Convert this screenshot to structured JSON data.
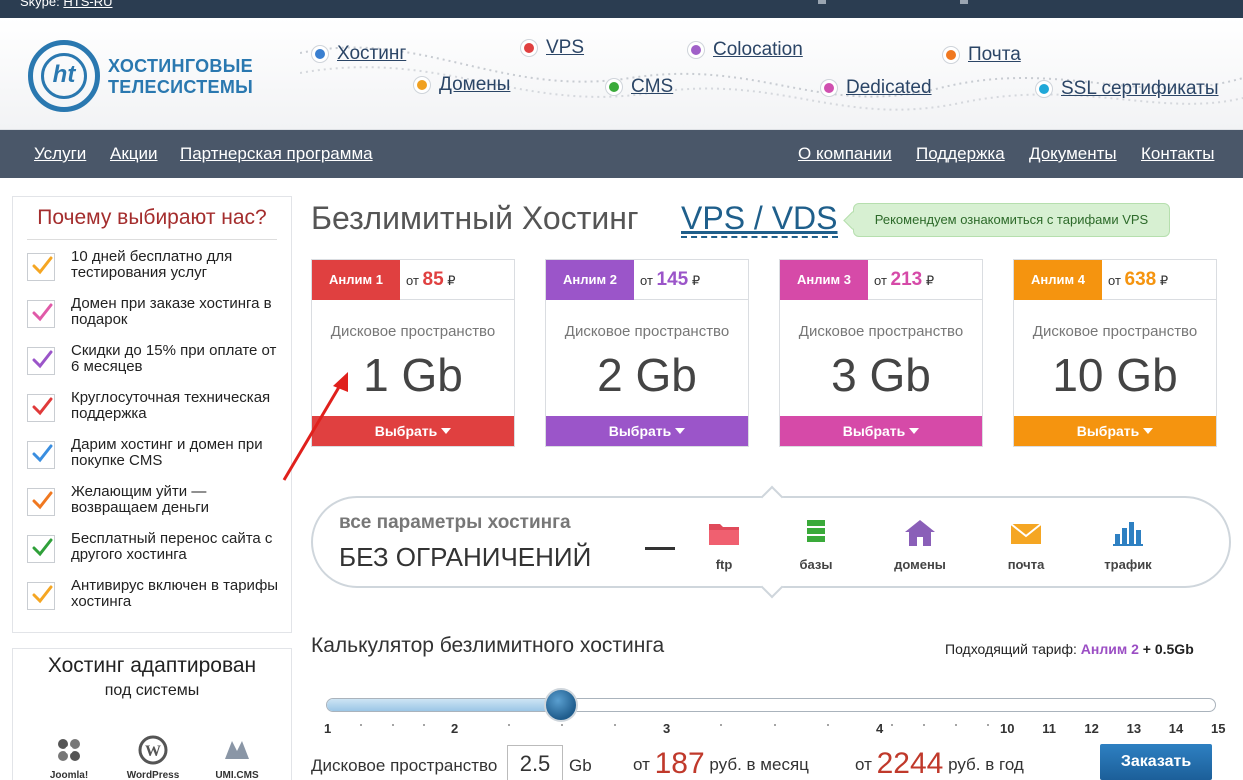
{
  "topbar": {
    "skype_label": "Skype:",
    "skype_id": "HTS-RU"
  },
  "logo": {
    "mark": "ht",
    "line1": "ХОСТИНГОВЫЕ",
    "line2": "ТЕЛЕСИСТЕМЫ"
  },
  "topnav": [
    {
      "label": "Хостинг",
      "color": "#3a7fd0"
    },
    {
      "label": "Домены",
      "color": "#f0a020"
    },
    {
      "label": "VPS",
      "color": "#e04040"
    },
    {
      "label": "CMS",
      "color": "#3aaa3a"
    },
    {
      "label": "Colocation",
      "color": "#a060c8"
    },
    {
      "label": "Dedicated",
      "color": "#d050b0"
    },
    {
      "label": "Почта",
      "color": "#f07820"
    },
    {
      "label": "SSL сертификаты",
      "color": "#20a8d8"
    }
  ],
  "mainnav_left": [
    "Услуги",
    "Акции",
    "Партнерская программа"
  ],
  "mainnav_right": [
    "О компании",
    "Поддержка",
    "Документы",
    "Контакты"
  ],
  "why": {
    "title": "Почему выбирают нас?",
    "items": [
      {
        "text": "10 дней бесплатно для тестирования услуг",
        "color": "#f5a623"
      },
      {
        "text": "Домен при заказе хостинга в подарок",
        "color": "#e05aa8"
      },
      {
        "text": "Скидки до 15% при оплате от 6 месяцев",
        "color": "#9b55c9"
      },
      {
        "text": "Круглосуточная техническая поддержка",
        "color": "#e03a3a"
      },
      {
        "text": "Дарим хостинг и домен при покупке CMS",
        "color": "#3a8ee0"
      },
      {
        "text": "Желающим уйти — возвращаем деньги",
        "color": "#f07820"
      },
      {
        "text": "Бесплатный перенос сайта с другого хостинга",
        "color": "#2fa03a"
      },
      {
        "text": "Антивирус включен в тарифы хостинга",
        "color": "#f5a623"
      }
    ]
  },
  "adapt": {
    "title": "Хостинг адаптирован",
    "subtitle": "под системы",
    "cms": [
      "Joomla!",
      "WordPress",
      "UMI.CMS"
    ]
  },
  "main": {
    "title": "Безлимитный Хостинг",
    "vps_link": "VPS / VDS",
    "recommend": "Рекомендуем ознакомиться с тарифами VPS"
  },
  "plans": [
    {
      "name": "Анлим 1",
      "from": "от",
      "price": "85",
      "currency": "₽",
      "disk_label": "Дисковое пространство",
      "size": "1 Gb",
      "button": "Выбрать",
      "color": "#e04040"
    },
    {
      "name": "Анлим 2",
      "from": "от",
      "price": "145",
      "currency": "₽",
      "disk_label": "Дисковое пространство",
      "size": "2 Gb",
      "button": "Выбрать",
      "color": "#9b55c9"
    },
    {
      "name": "Анлим 3",
      "from": "от",
      "price": "213",
      "currency": "₽",
      "disk_label": "Дисковое пространство",
      "size": "3 Gb",
      "button": "Выбрать",
      "color": "#d64aa8"
    },
    {
      "name": "Анлим 4",
      "from": "от",
      "price": "638",
      "currency": "₽",
      "disk_label": "Дисковое пространство",
      "size": "10 Gb",
      "button": "Выбрать",
      "color": "#f5940f"
    }
  ],
  "features": {
    "line1": "все параметры хостинга",
    "line2": "БЕЗ ОГРАНИЧЕНИЙ",
    "dash": "—",
    "items": [
      {
        "label": "ftp",
        "icon": "folder-icon",
        "color": "#e04a5a"
      },
      {
        "label": "базы",
        "icon": "database-icon",
        "color": "#3aaa3a"
      },
      {
        "label": "домены",
        "icon": "house-icon",
        "color": "#8a5fb8"
      },
      {
        "label": "почта",
        "icon": "envelope-icon",
        "color": "#f5a623"
      },
      {
        "label": "трафик",
        "icon": "bar-chart-icon",
        "color": "#2e80c2"
      }
    ]
  },
  "calculator": {
    "title": "Калькулятор безлимитного хостинга",
    "match_label": "Подходящий тариф:",
    "match_plan": "Анлим 2",
    "match_extra": "+ 0.5Gb",
    "slider_value": 2.5,
    "slider_min": 1,
    "slider_max": 15,
    "tick_labels": [
      "1",
      "2",
      "3",
      "4",
      "10",
      "11",
      "12",
      "13",
      "14",
      "15"
    ],
    "disk_label": "Дисковое пространство",
    "disk_value": "2.5",
    "disk_unit": "Gb",
    "month_from": "от",
    "month_price": "187",
    "month_unit": "руб. в месяц",
    "year_from": "от",
    "year_price": "2244",
    "year_unit": "руб. в год",
    "order_button": "Заказать"
  }
}
